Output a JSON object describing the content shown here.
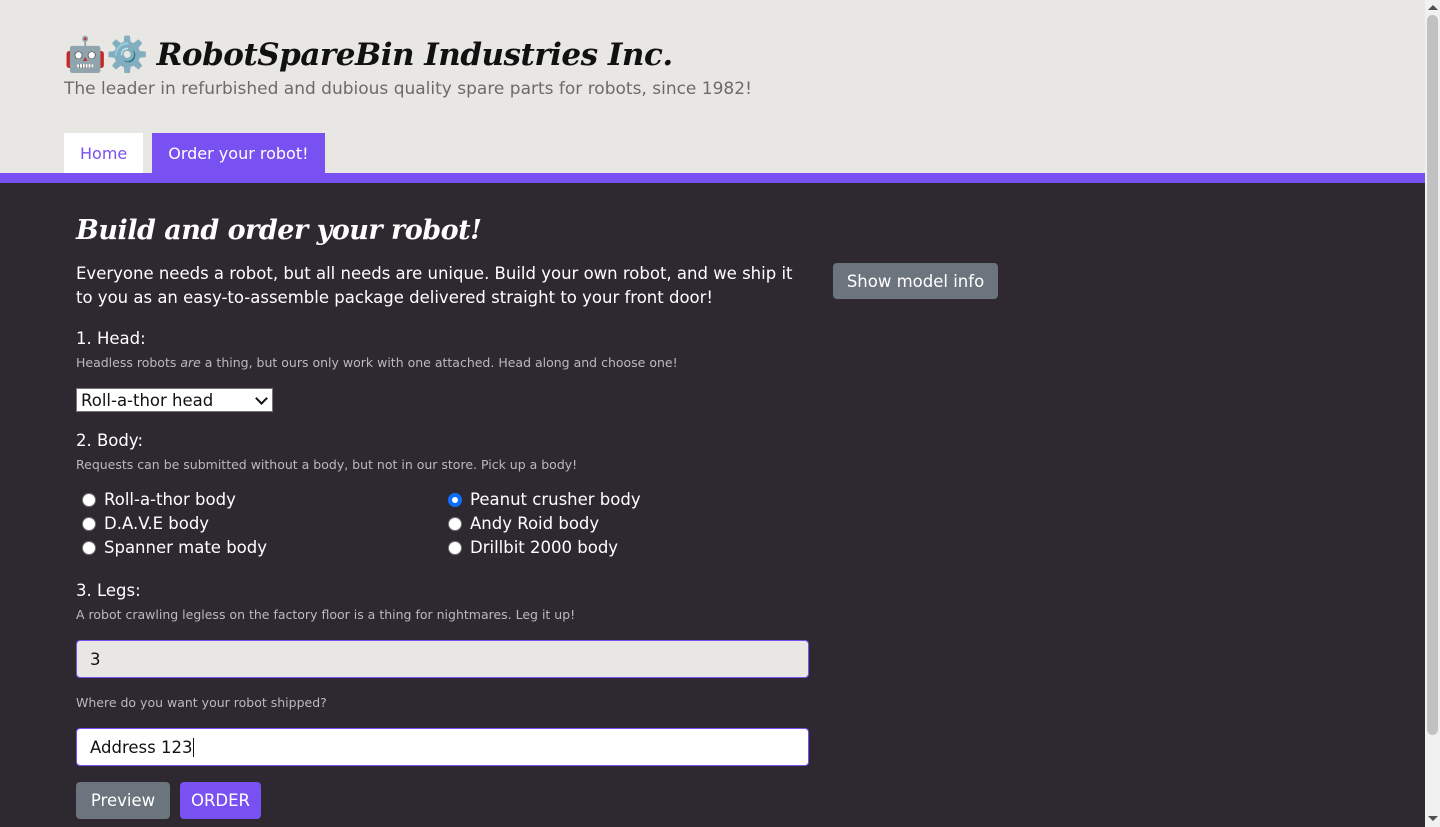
{
  "header": {
    "emojis": "🤖⚙️",
    "title": "RobotSpareBin Industries Inc.",
    "tagline": "The leader in refurbished and dubious quality spare parts for robots, since 1982!"
  },
  "nav": {
    "tabs": [
      {
        "label": "Home",
        "active": false
      },
      {
        "label": "Order your robot!",
        "active": true
      }
    ]
  },
  "colors": {
    "accent": "#7950f2",
    "header_bg": "#e9e7e4",
    "page_bg": "#2e2831",
    "secondary_button": "#6c757d"
  },
  "form": {
    "heading": "Build and order your robot!",
    "intro": "Everyone needs a robot, but all needs are unique. Build your own robot, and we ship it to you as an easy-to-assemble package delivered straight to your front door!",
    "head": {
      "label": "1. Head:",
      "hint_before": "Headless robots ",
      "hint_em": "are",
      "hint_after": " a thing, but ours only work with one attached. Head along and choose one!",
      "selected": "Roll-a-thor head"
    },
    "body": {
      "label": "2. Body:",
      "hint": "Requests can be submitted without a body, but not in our store. Pick up a body!",
      "options": [
        {
          "label": "Roll-a-thor body",
          "checked": false
        },
        {
          "label": "Peanut crusher body",
          "checked": true
        },
        {
          "label": "D.A.V.E body",
          "checked": false
        },
        {
          "label": "Andy Roid body",
          "checked": false
        },
        {
          "label": "Spanner mate body",
          "checked": false
        },
        {
          "label": "Drillbit 2000 body",
          "checked": false
        }
      ]
    },
    "legs": {
      "label": "3. Legs:",
      "hint": "A robot crawling legless on the factory floor is a thing for nightmares. Leg it up!",
      "value": "3"
    },
    "address": {
      "hint": "Where do you want your robot shipped?",
      "value": "Address 123"
    },
    "buttons": {
      "preview": "Preview",
      "order": "ORDER",
      "model_info": "Show model info"
    }
  }
}
